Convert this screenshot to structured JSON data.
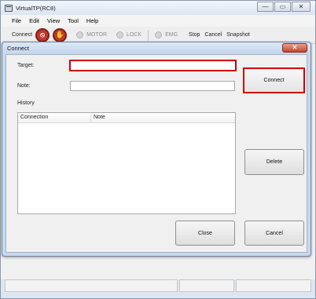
{
  "main_window": {
    "title": "VirtualTP(RC8)",
    "controls": {
      "minimize": "—",
      "maximize": "▭",
      "close": "✕"
    }
  },
  "menubar": {
    "items": [
      "File",
      "Edit",
      "View",
      "Tool",
      "Help"
    ]
  },
  "toolbar": {
    "connect": "Connect",
    "motor": "MOTOR",
    "lock": "LOCK",
    "emg": "EMG",
    "stop": "Stop",
    "cancel": "Cancel",
    "snapshot": "Snapshot"
  },
  "dialog": {
    "title": "Connect",
    "close_glyph": "✕",
    "target_label": "Target:",
    "target_value": "",
    "note_label": "Note:",
    "note_value": "",
    "history_label": "History",
    "history_columns": [
      "Connection",
      "Note"
    ],
    "buttons": {
      "connect": "Connect",
      "delete": "Delete",
      "close": "Close",
      "cancel": "Cancel"
    }
  },
  "colors": {
    "highlight": "#d00000",
    "dialog_frame": "#c7d8ec",
    "close_button": "#c7432b"
  },
  "icons": [
    "app-icon",
    "servo-off-icon",
    "emergency-hand-icon",
    "motor-led",
    "lock-led",
    "emg-led"
  ]
}
